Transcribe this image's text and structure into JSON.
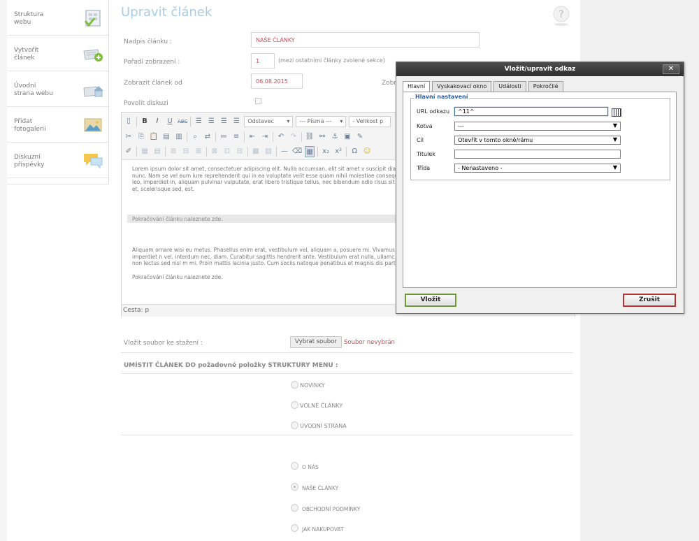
{
  "sidebar": {
    "items": [
      {
        "label": "Struktura\nwebu",
        "icon": "structure-icon"
      },
      {
        "label": "Vytvořit\nčlánek",
        "icon": "add-article-icon"
      },
      {
        "label": "Úvodní\nstrana webu",
        "icon": "home-page-icon"
      },
      {
        "label": "Přidat\nfotogalerii",
        "icon": "gallery-icon"
      },
      {
        "label": "Diskuzní\npříspěvky",
        "icon": "discussion-icon"
      }
    ]
  },
  "page": {
    "title": "Upravit článek",
    "help_icon": "help-icon"
  },
  "form": {
    "title_label": "Nadpis článku :",
    "title_value": "NAŠE ČLÁNKY",
    "order_label": "Pořadí zobrazení :",
    "order_value": "1",
    "order_hint": "(mezi ostatními články zvolené sekce)",
    "show_from_label": "Zobrazit článek od",
    "show_from_value": "06.08.2015",
    "show_to_label_partial": "Zobr",
    "discussion_label": "Povolit diskuzi"
  },
  "editor": {
    "format_select": "Odstavec",
    "font_select": "--- Písma ---",
    "size_select": "- Velikost p",
    "paragraph1": "Lorem ipsum dolor sit amet, consectetuer adipiscing elit. Nulla accumsan, elit sit amet v suscipit diam nulla vel leo. Pellentesque ipsum. Fusce consectetuer risus a nunc. Nam se vel eum iure reprehenderit qui in ea voluptate velit esse quam nihil molestiae consequat nulla pariatur? Maecenas sollicitudin. Mauris metus. Fusce dui leo, imperdiet in, aliquam pulvinar vulputate, erat libero tristique tellus, nec bibendum odio risus sit amet ante. Fu id erat. Donec ipsum massa, ullamcorper in, auctor et, scelerisque sed, est.",
    "pagebreak": "Pokračování článku naleznete zde.",
    "paragraph2": "Aliquam ornare wisi eu metus. Phasellus enim erat, vestibulum vel, aliquam a, posuere mi. Vivamus ac leo pretium faucibus. Aliquam erat volutpat. In enim a arcu imperdiet n vel, interdum nec, diam. Curabitur sagittis hendrerit ante. Vestibulum erat nulla, ullamc ipsum massa, ullamcorper in, auctor et, scelerisque sed, est. Nulla non lectus sed nisl m mi. Proin mattis lacinia justo. Cum sociis natoque penatibus et magnis dis parturient mo",
    "paragraph3": "Pokračování článku naleznete zde.",
    "path": "Cesta: p"
  },
  "file": {
    "label": "Vložit soubor ke stažení :",
    "button": "Vybrat soubor",
    "status": "Soubor nevybrán"
  },
  "menu_section": {
    "heading": "UMÍSTIT ČLÁNEK DO požadovné položky STRUKTURY MENU :",
    "group1": [
      "NOVINKY",
      "VOLNÉ ČLÁNKY",
      "ÚVODNÍ STRANA"
    ],
    "group2": [
      "O NÁS",
      "NAŠE ČLÁNKY",
      "OBCHODNÍ PODMÍNKY",
      "JAK NAKUPOVAT"
    ],
    "selected": "NAŠE ČLÁNKY"
  },
  "dialog": {
    "title": "Vložit/upravit odkaz",
    "close": "✕",
    "tabs": [
      "Hlavní",
      "Vyskakovací okno",
      "Události",
      "Pokročilé"
    ],
    "active_tab": "Hlavní",
    "legend": "Hlavní nastavení",
    "fields": {
      "url_label": "URL odkazu",
      "url_value": "^11^",
      "anchor_label": "Kotva",
      "anchor_value": "---",
      "target_label": "Cíl",
      "target_value": "Otevřít v tomto okně/rámu",
      "title_label": "Titulek",
      "title_value": "",
      "class_label": "Třída",
      "class_value": "- Nenastaveno -"
    },
    "insert_button": "Vložit",
    "cancel_button": "Zrušit"
  },
  "colors": {
    "accent_title": "#a8cde4",
    "value_red": "#c1505a",
    "insert_border": "#6c9a3c",
    "cancel_border": "#bb3333"
  }
}
